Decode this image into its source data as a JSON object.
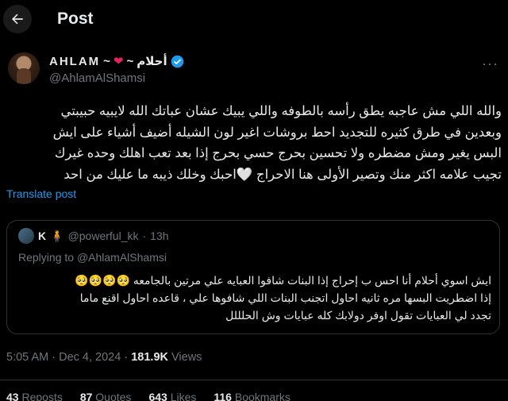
{
  "header": {
    "title": "Post"
  },
  "author": {
    "name_latin": "AHLAM",
    "name_sep1": "~",
    "heart": "❤",
    "name_sep2": "~",
    "name_arabic": "أحلام",
    "handle": "@AhlamAlShamsi",
    "more": "···"
  },
  "tweet": {
    "lines": [
      "والله اللي مش عاجبه يطق رأسه بالطوفه واللي يبيك عشان عباتك الله لايبيه حبيبتي",
      "وبعدين في طرق كثيره للتجديد احط بروشات اغير لون الشيله أضيف أشياء على ايش",
      "البس يغير ومش مضطره ولا تحسين بحرج حسي بحرج إذا بعد تعب اهلك وحده غيرك",
      "تجيب علامه اكثر منك وتصير الأولى هنا الاحراج 🤍احبك وخلك ذيبه ما عليك من احد"
    ],
    "translate": "Translate post"
  },
  "quote": {
    "name": "K",
    "emoji": "🧍",
    "handle": "@powerful_kk",
    "dot": "·",
    "time": "13h",
    "replying_prefix": "Replying to",
    "replying_to": "@AhlamAlShamsi",
    "lines": [
      "ايش اسوي أحلام أنا احس ب إحراج إذا البنات شافوا العبايه علي مرتين بالجامعه 🥺🥺🥺🥺",
      "إذا اضطريت البسها مره ثانيه احاول اتجنب البنات اللي شافوها علي ، قاعده احاول اقنع ماما",
      "تجدد لي العبايات تقول اوفر دولابك كله عبايات وش الحلللل"
    ]
  },
  "meta": {
    "time": "5:05 AM",
    "dot1": "·",
    "date": "Dec 4, 2024",
    "dot2": "·",
    "views_count": "181.9K",
    "views_label": "Views"
  },
  "stats": {
    "reposts_count": "43",
    "reposts_label": "Reposts",
    "quotes_count": "87",
    "quotes_label": "Quotes",
    "likes_count": "643",
    "likes_label": "Likes",
    "bookmarks_count": "116",
    "bookmarks_label": "Bookmarks"
  },
  "colors": {
    "background": "#000000",
    "accent": "#1d9bf0",
    "muted": "#71767b",
    "heart": "#e0245e"
  }
}
